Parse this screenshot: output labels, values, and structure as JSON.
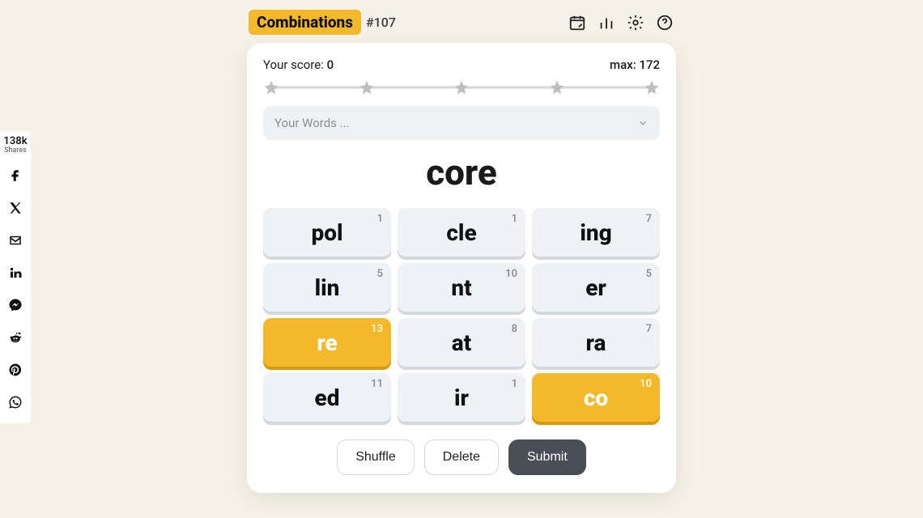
{
  "share": {
    "count": "138k",
    "count_label": "Shares"
  },
  "header": {
    "title": "Combinations",
    "puzzle_number": "#107"
  },
  "score": {
    "your_label": "Your score:",
    "your_value": "0",
    "max_label": "max:",
    "max_value": "172"
  },
  "words_dropdown": {
    "placeholder": "Your Words ..."
  },
  "current_word": "core",
  "tiles": [
    {
      "text": "pol",
      "count": "1",
      "active": false
    },
    {
      "text": "cle",
      "count": "1",
      "active": false
    },
    {
      "text": "ing",
      "count": "7",
      "active": false
    },
    {
      "text": "lin",
      "count": "5",
      "active": false
    },
    {
      "text": "nt",
      "count": "10",
      "active": false
    },
    {
      "text": "er",
      "count": "5",
      "active": false
    },
    {
      "text": "re",
      "count": "13",
      "active": true
    },
    {
      "text": "at",
      "count": "8",
      "active": false
    },
    {
      "text": "ra",
      "count": "7",
      "active": false
    },
    {
      "text": "ed",
      "count": "11",
      "active": false
    },
    {
      "text": "ir",
      "count": "1",
      "active": false
    },
    {
      "text": "co",
      "count": "10",
      "active": true
    }
  ],
  "buttons": {
    "shuffle": "Shuffle",
    "delete": "Delete",
    "submit": "Submit"
  }
}
